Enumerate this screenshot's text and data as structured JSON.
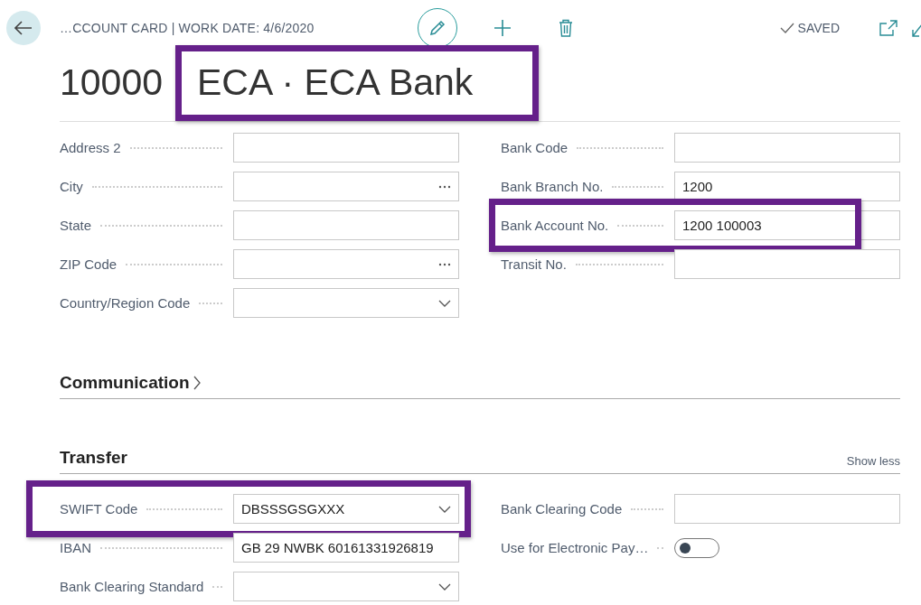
{
  "header": {
    "breadcrumb": "…CCOUNT CARD | WORK DATE: 4/6/2020",
    "status": "SAVED"
  },
  "title": {
    "number": "10000",
    "name": "ECA · ECA Bank",
    "highlighted": true
  },
  "general": {
    "left": [
      {
        "label": "Address 2",
        "kind": "text"
      },
      {
        "label": "City",
        "kind": "lookup"
      },
      {
        "label": "State",
        "kind": "text"
      },
      {
        "label": "ZIP Code",
        "kind": "lookup"
      },
      {
        "label": "Country/Region Code",
        "kind": "dropdown"
      }
    ],
    "right": [
      {
        "label": "Bank Code",
        "kind": "text"
      },
      {
        "label": "Bank Branch No.",
        "kind": "text",
        "value": "1200"
      },
      {
        "label": "Bank Account No.",
        "kind": "text",
        "value": "1200 100003",
        "highlighted": true
      },
      {
        "label": "Transit No.",
        "kind": "text"
      }
    ]
  },
  "sections": [
    {
      "title": "Communication",
      "expanded": false
    },
    {
      "title": "Transfer",
      "expanded": true,
      "action": "Show less",
      "left": [
        {
          "label": "SWIFT Code",
          "kind": "dropdown",
          "value": "DBSSSGSGXXX",
          "highlighted": true
        },
        {
          "label": "IBAN",
          "kind": "text",
          "value": "GB 29 NWBK 60161331926819"
        },
        {
          "label": "Bank Clearing Standard",
          "kind": "dropdown"
        }
      ],
      "right": [
        {
          "label": "Bank Clearing Code",
          "kind": "text"
        },
        {
          "label": "Use for Electronic Pay…",
          "kind": "toggle",
          "on": false
        }
      ]
    }
  ]
}
